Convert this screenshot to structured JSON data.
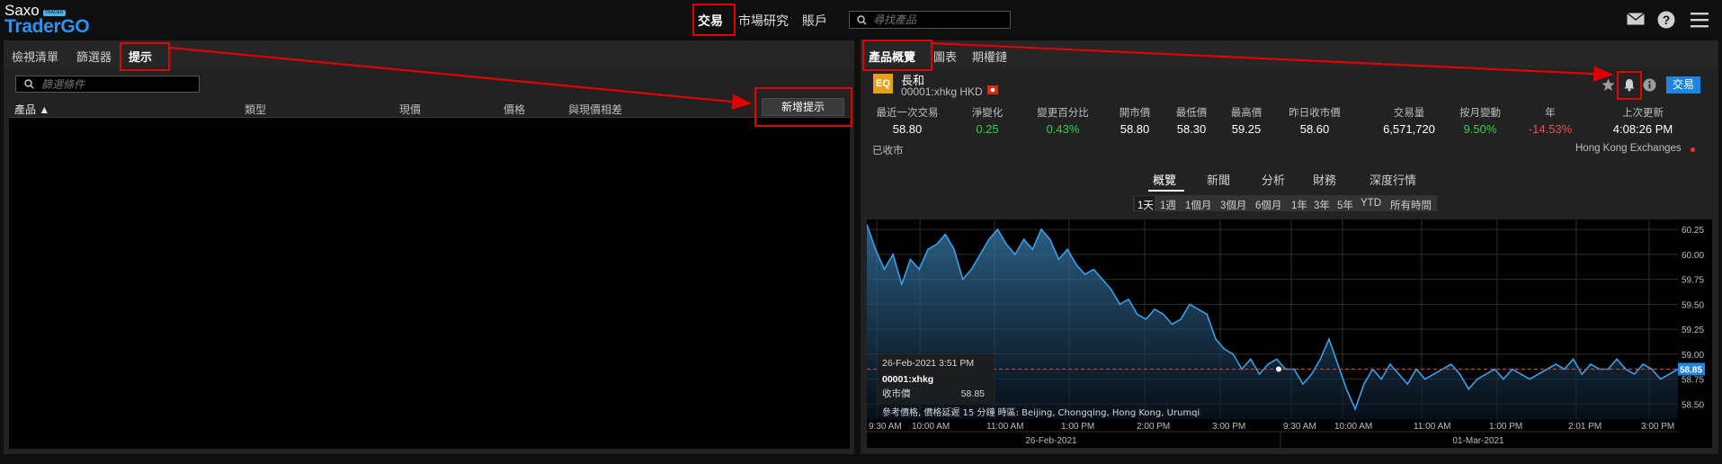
{
  "app": {
    "brand_top": "Saxo",
    "brand_badge": "TRADER",
    "brand_bottom": "TraderGO"
  },
  "top_nav": {
    "items": [
      "交易",
      "市場研究",
      "賬戶"
    ],
    "active": "交易"
  },
  "search": {
    "placeholder": "尋找產品"
  },
  "top_icons": [
    "mail-icon",
    "help-icon",
    "menu-icon"
  ],
  "left_panel": {
    "tabs": [
      "檢視清單",
      "篩選器",
      "提示"
    ],
    "active_tab": "提示",
    "filter_placeholder": "篩選條件",
    "columns": [
      "產品 ▲",
      "類型",
      "現價",
      "價格",
      "與現價相差"
    ],
    "add_alert_label": "新增提示"
  },
  "right_panel": {
    "tabs": [
      "產品概覽",
      "圖表",
      "期權鏈"
    ],
    "active_tab": "產品概覽",
    "asset_badge": "EQ",
    "product_name": "長和",
    "product_symbol": "00001:xhkg HKD",
    "trade_label": "交易",
    "stats": [
      {
        "label": "最近一次交易",
        "value": "58.80",
        "tone": "neutral"
      },
      {
        "label": "淨變化",
        "value": "0.25",
        "tone": "pos"
      },
      {
        "label": "變更百分比",
        "value": "0.43%",
        "tone": "pos"
      },
      {
        "label": "開市價",
        "value": "58.80",
        "tone": "neutral"
      },
      {
        "label": "最低價",
        "value": "58.30",
        "tone": "neutral"
      },
      {
        "label": "最高價",
        "value": "59.25",
        "tone": "neutral"
      },
      {
        "label": "昨日收市價",
        "value": "58.60",
        "tone": "neutral"
      },
      {
        "label": "交易量",
        "value": "6,571,720",
        "tone": "neutral"
      },
      {
        "label": "按月變動",
        "value": "9.50%",
        "tone": "pos"
      },
      {
        "label": "年",
        "value": "-14.53%",
        "tone": "neg"
      },
      {
        "label": "上次更新",
        "value": "4:08:26 PM",
        "tone": "neutral"
      }
    ],
    "market_status": "已收市",
    "exchange": "Hong Kong Exchanges",
    "sub_tabs": [
      "概覽",
      "新聞",
      "分析",
      "財務",
      "深度行情"
    ],
    "active_sub_tab": "概覽",
    "ranges": [
      "1天",
      "1週",
      "1個月",
      "3個月",
      "6個月",
      "1年",
      "3年",
      "5年",
      "YTD",
      "所有時間"
    ],
    "active_range": "1天"
  },
  "colors": {
    "accent": "#1e86e0",
    "positive": "#2fd045",
    "negative": "#f04a4a",
    "highlight": "#e00000",
    "line": "#3aa0e8"
  },
  "chart_data": {
    "type": "area",
    "series_label": "00001:xhkg",
    "x_ticks": [
      "9:30 AM",
      "10:00 AM",
      "11:00 AM",
      "1:00 PM",
      "2:00 PM",
      "3:00 PM",
      "9:30 AM",
      "10:00 AM",
      "11:00 AM",
      "1:00 PM",
      "2:01 PM",
      "3:00 PM"
    ],
    "date_labels": [
      "26-Feb-2021",
      "01-Mar-2021"
    ],
    "y_ticks": [
      "60.25",
      "60.00",
      "59.75",
      "59.50",
      "59.25",
      "59.00",
      "58.75",
      "58.50"
    ],
    "ylim": [
      58.35,
      60.35
    ],
    "reference_line": 58.85,
    "last_value_label": "58.85",
    "tooltip": {
      "time": "26-Feb-2021 3:51 PM",
      "symbol": "00001:xhkg",
      "label": "收市價",
      "value": "58.85"
    },
    "footnote": "參考價格, 價格延遲 15 分鐘   時區: Beijing, Chongqing, Hong Kong, Urumqi",
    "values": [
      60.3,
      60.05,
      59.85,
      60.0,
      59.7,
      59.95,
      59.85,
      60.05,
      60.1,
      60.2,
      60.05,
      59.75,
      59.85,
      60.0,
      60.15,
      60.25,
      60.1,
      60.0,
      60.15,
      60.05,
      60.25,
      60.15,
      59.95,
      60.05,
      59.9,
      59.8,
      59.85,
      59.75,
      59.65,
      59.5,
      59.55,
      59.4,
      59.35,
      59.45,
      59.4,
      59.3,
      59.35,
      59.5,
      59.45,
      59.4,
      59.15,
      59.05,
      59.0,
      58.85,
      58.95,
      58.8,
      58.9,
      58.95,
      58.85,
      58.85,
      58.7,
      58.8,
      58.95,
      59.15,
      58.9,
      58.65,
      58.45,
      58.7,
      58.85,
      58.75,
      58.9,
      58.8,
      58.7,
      58.85,
      58.75,
      58.8,
      58.85,
      58.9,
      58.8,
      58.65,
      58.75,
      58.8,
      58.85,
      58.75,
      58.85,
      58.8,
      58.75,
      58.8,
      58.85,
      58.9,
      58.85,
      58.95,
      58.8,
      58.9,
      58.85,
      58.85,
      58.95,
      58.85,
      58.8,
      58.9,
      58.85,
      58.75,
      58.8,
      58.85
    ]
  }
}
